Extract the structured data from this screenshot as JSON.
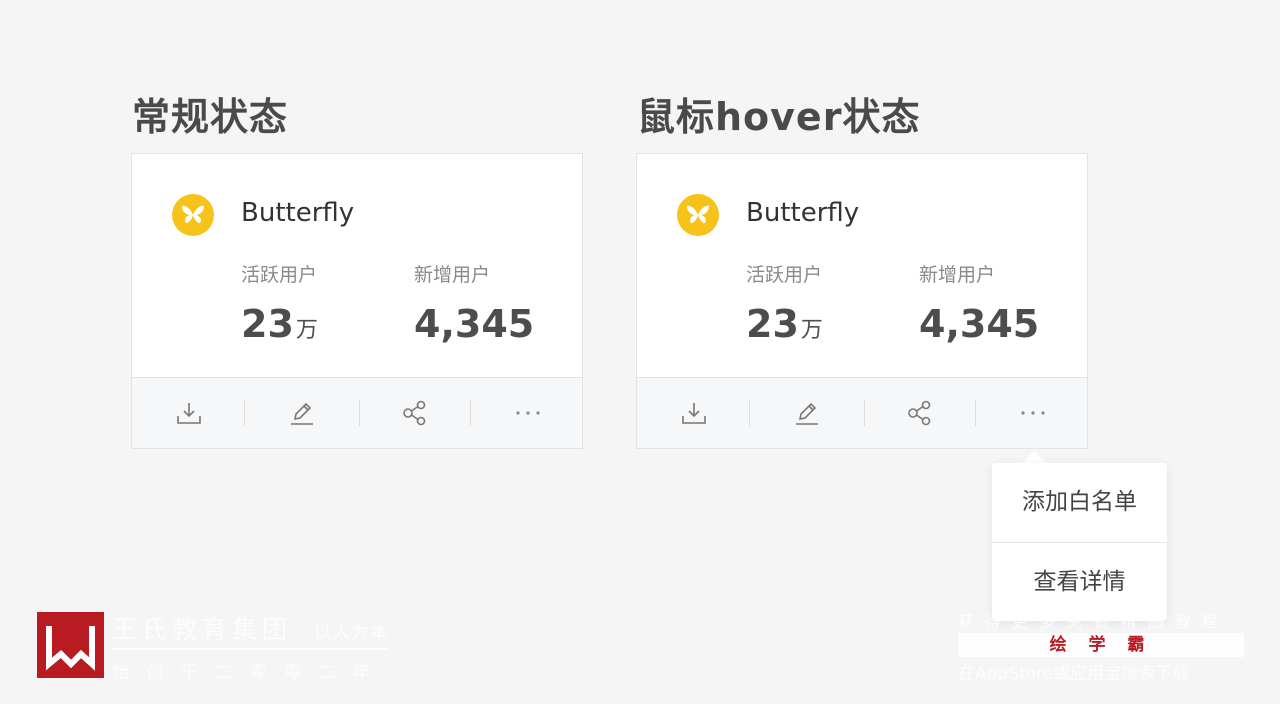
{
  "sections": {
    "normal_title": "常规状态",
    "hover_title": "鼠标hover状态"
  },
  "card": {
    "app_name": "Butterfly",
    "logo_icon": "butterfly-icon",
    "logo_color": "#f7c21a",
    "stats": [
      {
        "label": "活跃用户",
        "value": "23",
        "unit": "万"
      },
      {
        "label": "新增用户",
        "value": "4,345",
        "unit": ""
      }
    ],
    "toolbar_icons": [
      "download-icon",
      "edit-icon",
      "share-icon",
      "more-icon"
    ]
  },
  "dropdown": {
    "items": [
      "添加白名单",
      "查看详情"
    ]
  },
  "watermark_left": {
    "brand": "王氏教育集团",
    "slogan": "以人为本",
    "tagline": "始 创 于 二 零 零 二 年",
    "logo_color": "#b81c22"
  },
  "watermark_right": {
    "line1": "获 得 更 多 免 费 精 品 教 程",
    "line2": "绘 学 霸",
    "line3": "在AppStore或应用宝搜索下载"
  }
}
